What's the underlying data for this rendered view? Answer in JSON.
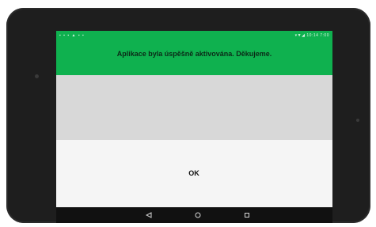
{
  "status_bar": {
    "left_icons": [
      "notification-icon",
      "notification-icon",
      "notification-icon",
      "warning-icon",
      "notification-icon",
      "notification-icon"
    ],
    "right_text": "▾▼◢ 10:14 7:00"
  },
  "dialog": {
    "message": "Aplikace byla úspěšně aktivována. Děkujeme.",
    "ok_label": "OK"
  },
  "navigation": {
    "buttons": [
      "back-icon",
      "home-icon",
      "recent-apps-icon"
    ]
  },
  "colors": {
    "header": "#0fb14f",
    "content": "#d8d8d8",
    "panel": "#f5f5f5",
    "nav": "#111111"
  }
}
